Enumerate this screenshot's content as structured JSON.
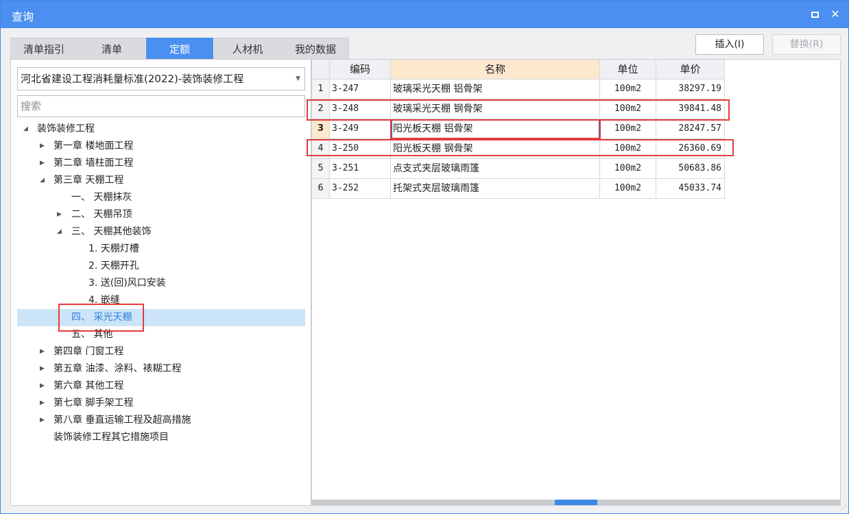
{
  "window": {
    "title": "查询"
  },
  "tabs": [
    "清单指引",
    "清单",
    "定额",
    "人材机",
    "我的数据"
  ],
  "buttons": {
    "insert": "插入(I)",
    "replace": "替换(R)"
  },
  "library_select": {
    "value": "河北省建设工程消耗量标准(2022)-装饰装修工程"
  },
  "search": {
    "placeholder": "搜索"
  },
  "tree": [
    "装饰装修工程",
    "第一章 楼地面工程",
    "第二章 墙柱面工程",
    "第三章 天棚工程",
    "一、 天棚抹灰",
    "二、 天棚吊顶",
    "三、 天棚其他装饰",
    "1. 天棚灯槽",
    "2. 天棚开孔",
    "3. 送(回)风口安装",
    "4. 嵌缝",
    "四、 采光天棚",
    "五、 其他",
    "第四章 门窗工程",
    "第五章 油漆、涂料、裱糊工程",
    "第六章 其他工程",
    "第七章 脚手架工程",
    "第八章 垂直运输工程及超高措施",
    "装饰装修工程其它措施项目"
  ],
  "table": {
    "headers": [
      "编码",
      "名称",
      "单位",
      "单价"
    ],
    "rows": [
      {
        "n": "1",
        "code": "3-247",
        "name": "玻璃采光天棚 铝骨架",
        "unit": "100m2",
        "price": "38297.19"
      },
      {
        "n": "2",
        "code": "3-248",
        "name": "玻璃采光天棚 钢骨架",
        "unit": "100m2",
        "price": "39841.48"
      },
      {
        "n": "3",
        "code": "3-249",
        "name": "阳光板天棚 铝骨架",
        "unit": "100m2",
        "price": "28247.57"
      },
      {
        "n": "4",
        "code": "3-250",
        "name": "阳光板天棚 钢骨架",
        "unit": "100m2",
        "price": "26360.69"
      },
      {
        "n": "5",
        "code": "3-251",
        "name": "点支式夹层玻璃雨篷",
        "unit": "100m2",
        "price": "50683.86"
      },
      {
        "n": "6",
        "code": "3-252",
        "name": "托架式夹层玻璃雨篷",
        "unit": "100m2",
        "price": "45033.74"
      }
    ]
  },
  "colors": {
    "accent": "#4b8ff0",
    "highlight": "#e53b3b",
    "selected_bg": "#cce4f7"
  }
}
